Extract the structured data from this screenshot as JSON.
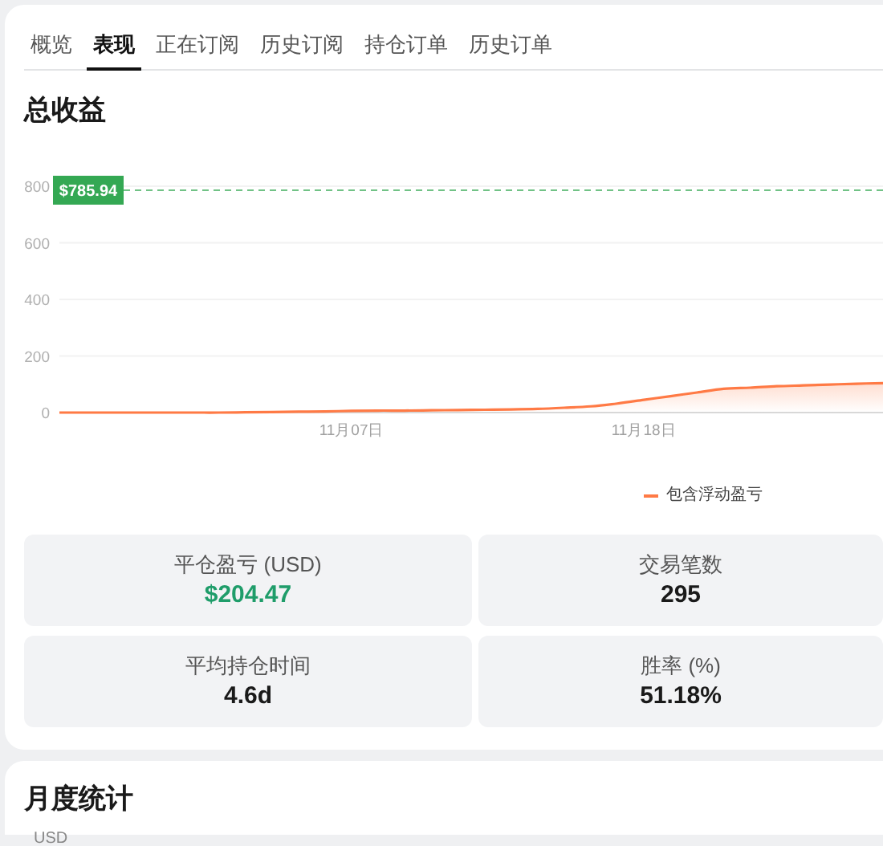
{
  "tabs": [
    {
      "label": "概览",
      "selected": false
    },
    {
      "label": "表现",
      "selected": true
    },
    {
      "label": "正在订阅",
      "selected": false
    },
    {
      "label": "历史订阅",
      "selected": false
    },
    {
      "label": "持仓订单",
      "selected": false
    },
    {
      "label": "历史订单",
      "selected": false
    }
  ],
  "performance": {
    "title": "总收益",
    "chart_data": {
      "type": "area",
      "categories": [
        null,
        null,
        null,
        null,
        null,
        null,
        null,
        null,
        null,
        null,
        null,
        "11月07日",
        null,
        null,
        null,
        null,
        null,
        null,
        null,
        null,
        null,
        null,
        "11月18日",
        null,
        null,
        null,
        null,
        null,
        null,
        null,
        null,
        null
      ],
      "series": [
        {
          "name": "包含浮动盈亏",
          "color": "#ff7a45",
          "values": [
            0,
            0,
            0,
            0,
            0,
            0,
            0,
            1,
            2,
            3,
            4,
            6,
            7,
            7,
            8,
            9,
            10,
            11,
            13,
            17,
            22,
            32,
            45,
            58,
            71,
            84,
            88,
            93,
            96,
            99,
            102,
            104
          ]
        }
      ],
      "grid": true,
      "ylim": [
        0,
        800
      ],
      "yticks": [
        0,
        200,
        400,
        600,
        800
      ],
      "annotations": [
        {
          "text": "$785.94",
          "y": 785.94
        }
      ]
    },
    "stats": [
      {
        "label": "平仓盈亏 (USD)",
        "value": "$204.47",
        "highlight": true
      },
      {
        "label": "交易笔数",
        "value": "295",
        "highlight": false
      },
      {
        "label": "平均持仓时间",
        "value": "4.6d",
        "highlight": false
      },
      {
        "label": "胜率 (%)",
        "value": "51.18%",
        "highlight": false
      }
    ]
  },
  "monthly": {
    "title": "月度统计",
    "unit": "USD"
  }
}
